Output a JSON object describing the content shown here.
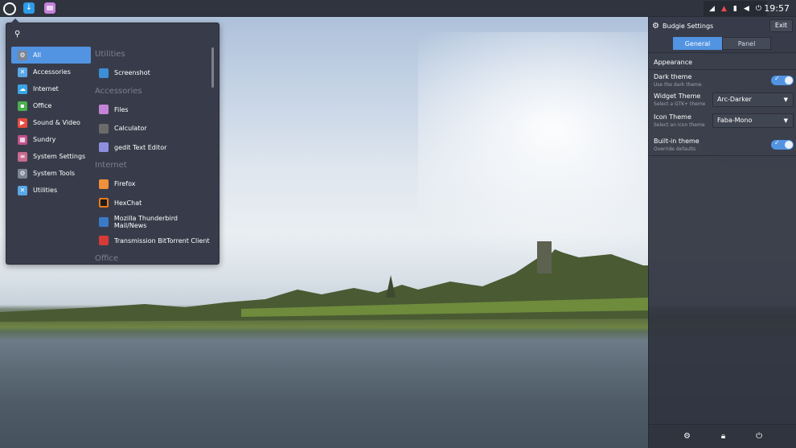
{
  "panel": {
    "clock": "19:57",
    "tray_icons": [
      "network-icon",
      "bell-icon",
      "battery-icon",
      "volume-icon",
      "power-icon"
    ]
  },
  "menu": {
    "search_placeholder": "",
    "categories": [
      {
        "label": "All",
        "icon": "gear-icon",
        "color": "#7c8594"
      },
      {
        "label": "Accessories",
        "icon": "accessories-icon",
        "color": "#5aa7e6"
      },
      {
        "label": "Internet",
        "icon": "cloud-icon",
        "color": "#3aa5e4"
      },
      {
        "label": "Office",
        "icon": "office-icon",
        "color": "#4caf50"
      },
      {
        "label": "Sound & Video",
        "icon": "play-icon",
        "color": "#e84a3f"
      },
      {
        "label": "Sundry",
        "icon": "grid-icon",
        "color": "#c0508c"
      },
      {
        "label": "System Settings",
        "icon": "settings-icon",
        "color": "#c86b8f"
      },
      {
        "label": "System Tools",
        "icon": "tools-icon",
        "color": "#7c8594"
      },
      {
        "label": "Utilities",
        "icon": "utilities-icon",
        "color": "#5aa7e6"
      }
    ],
    "app_groups": [
      {
        "header": "Utilities",
        "apps": [
          {
            "label": "Screenshot",
            "icon": "camera-icon",
            "color": "#3b8fd6"
          }
        ]
      },
      {
        "header": "Accessories",
        "apps": [
          {
            "label": "Files",
            "icon": "folder-icon",
            "color": "#c483d6"
          },
          {
            "label": "Calculator",
            "icon": "calculator-icon",
            "color": "#6b6b6b"
          },
          {
            "label": "gedit Text Editor",
            "icon": "text-editor-icon",
            "color": "#8e8ee0"
          }
        ]
      },
      {
        "header": "Internet",
        "apps": [
          {
            "label": "Firefox",
            "icon": "firefox-icon",
            "color": "#f0903a"
          },
          {
            "label": "HexChat",
            "icon": "hexchat-icon",
            "color": "#1b1b1b"
          },
          {
            "label": "Mozilla Thunderbird Mail/News",
            "icon": "mail-icon",
            "color": "#3a7ac8"
          },
          {
            "label": "Transmission BitTorrent Client",
            "icon": "torrent-icon",
            "color": "#d83a36"
          }
        ]
      },
      {
        "header": "Office",
        "apps": []
      }
    ]
  },
  "settings": {
    "title": "Budgie Settings",
    "exit_label": "Exit",
    "tabs": [
      "General",
      "Panel"
    ],
    "section": "Appearance",
    "dark_theme": {
      "label": "Dark theme",
      "sub": "Use the dark theme"
    },
    "widget_theme": {
      "label": "Widget Theme",
      "sub": "Select a GTK+ theme",
      "value": "Arc-Darker"
    },
    "icon_theme": {
      "label": "Icon Theme",
      "sub": "Select an icon theme",
      "value": "Faba-Mono"
    },
    "builtin_theme": {
      "label": "Built-in theme",
      "sub": "Override defaults"
    },
    "footer_icons": [
      "gear-icon",
      "lock-icon",
      "power-icon"
    ]
  },
  "colors": {
    "accent": "#5294e2",
    "panel_bg": "#2f343f",
    "menu_bg": "#383c4a"
  }
}
